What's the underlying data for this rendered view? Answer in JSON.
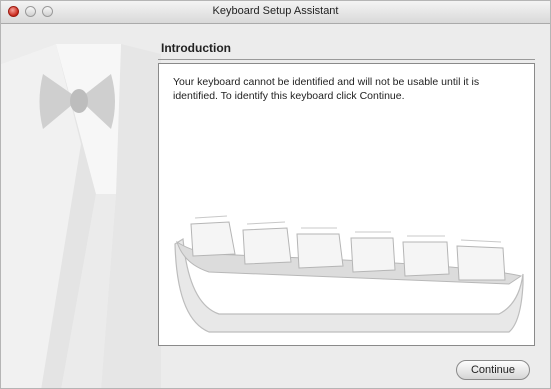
{
  "window": {
    "title": "Keyboard Setup Assistant"
  },
  "page": {
    "heading": "Introduction",
    "body_text": "Your keyboard cannot be identified and will not be usable until it is identified. To identify this keyboard click Continue."
  },
  "buttons": {
    "continue_label": "Continue"
  },
  "icons": {
    "close": "close-icon",
    "minimize": "minimize-icon",
    "zoom": "zoom-icon",
    "keyboard_illustration": "keyboard-illustration",
    "tuxedo_illustration": "tuxedo-illustration"
  },
  "colors": {
    "close_red": "#c9271a",
    "window_bg": "#ececec",
    "panel_bg": "#ffffff"
  }
}
